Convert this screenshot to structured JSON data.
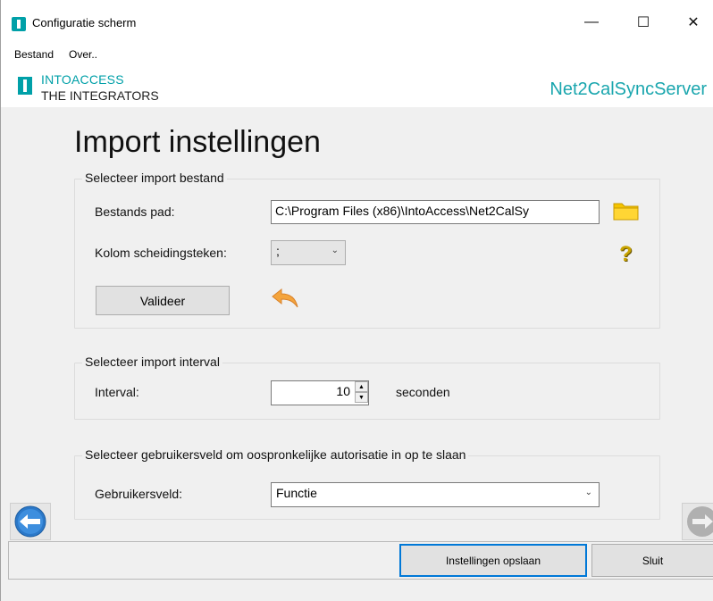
{
  "window": {
    "title": "Configuratie scherm",
    "minimize": "—",
    "maximize": "☐",
    "close": "✕"
  },
  "menu": {
    "items": [
      "Bestand",
      "Over.."
    ]
  },
  "brand": {
    "line1": "INTOACCESS",
    "line2": "THE INTEGRATORS",
    "product": "Net2CalSyncServer"
  },
  "page": {
    "title": "Import instellingen"
  },
  "import_file": {
    "legend": "Selecteer import bestand",
    "path_label": "Bestands pad:",
    "path_value": "C:\\Program Files (x86)\\IntoAccess\\Net2CalSy",
    "separator_label": "Kolom scheidingsteken:",
    "separator_value": ";",
    "validate_label": "Valideer"
  },
  "interval": {
    "legend": "Selecteer import interval",
    "label": "Interval:",
    "value": "10",
    "unit": "seconden"
  },
  "user_field": {
    "legend": "Selecteer gebruikersveld om oospronkelijke autorisatie in op te slaan",
    "label": "Gebruikersveld:",
    "value": "Functie"
  },
  "footer": {
    "save_label": "Instellingen opslaan",
    "close_label": "Sluit"
  },
  "colors": {
    "brand": "#00a0a8",
    "folder": "#f5c400",
    "help": "#c9a400",
    "back_arrow": "#f4a43c",
    "nav_left": "#2b78c8",
    "nav_right": "#b0b0b0"
  }
}
